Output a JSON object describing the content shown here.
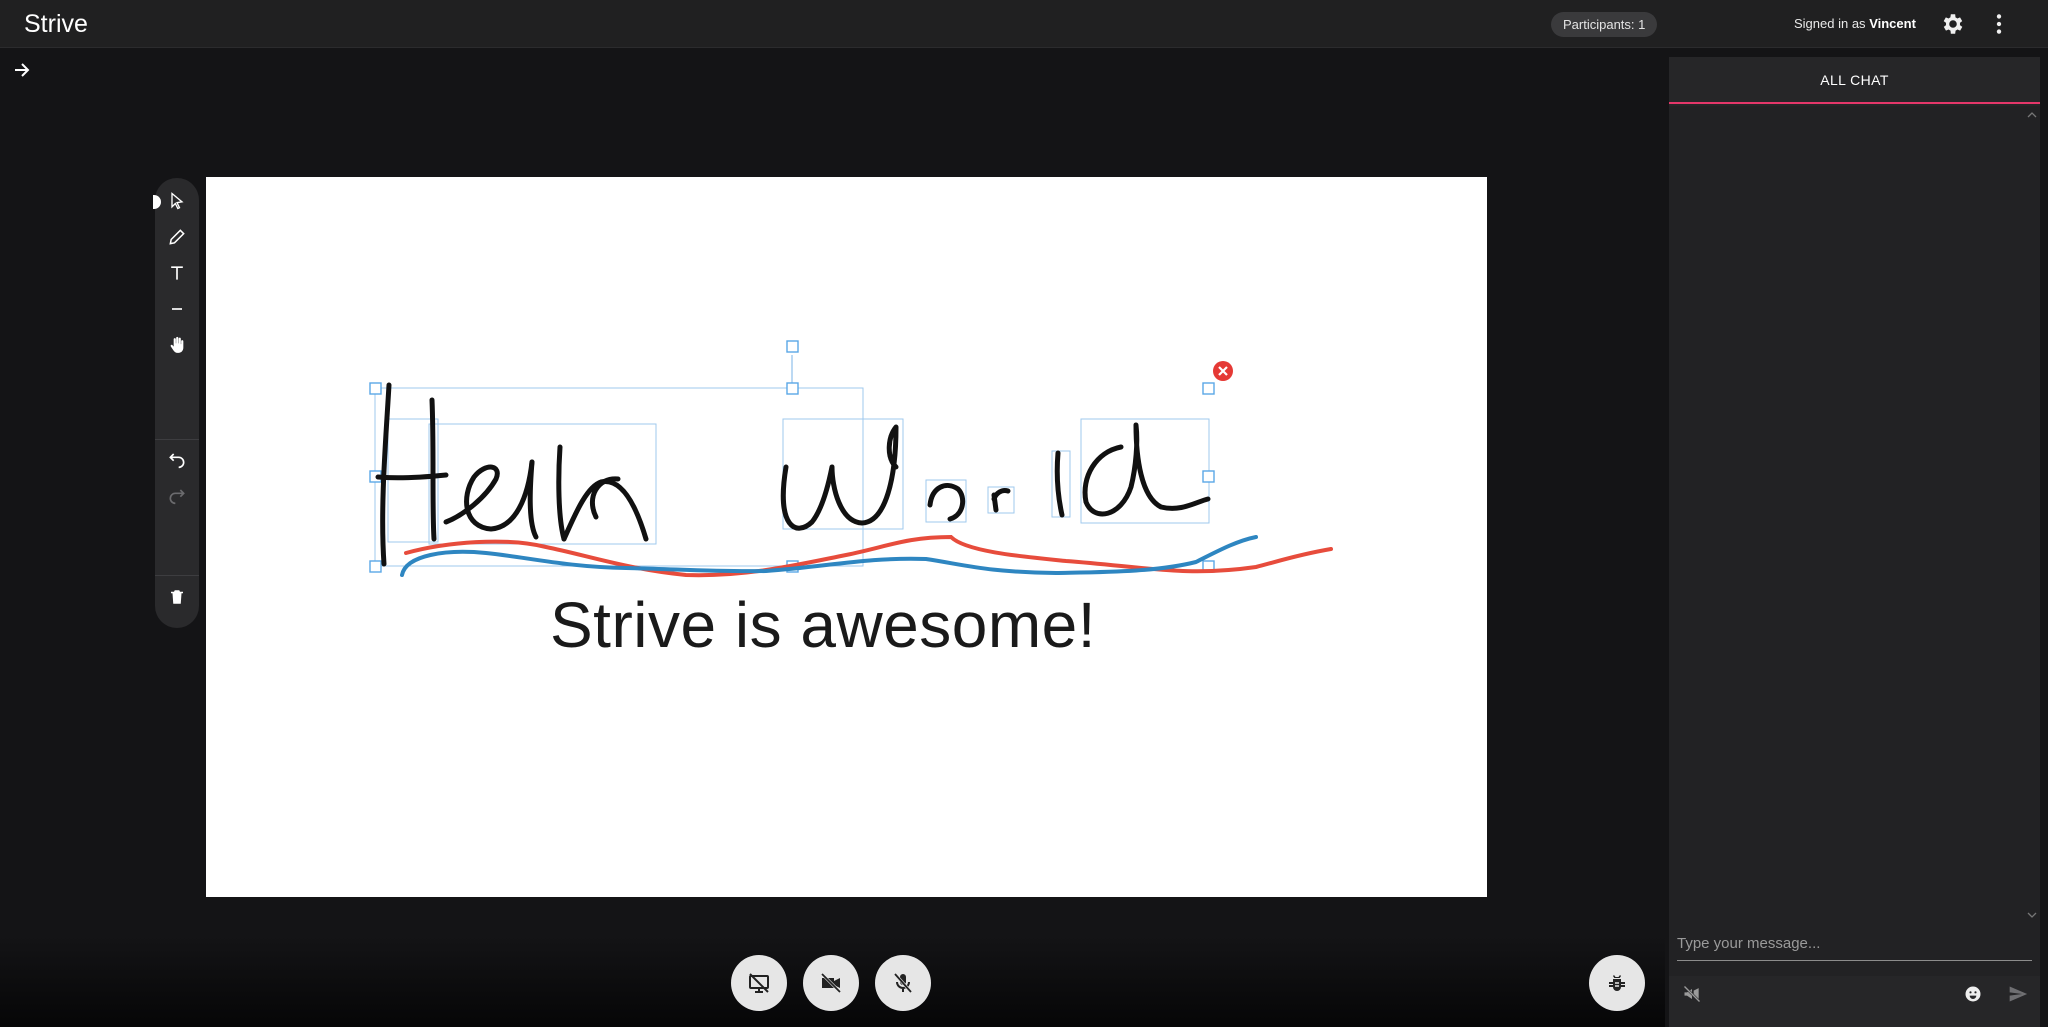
{
  "app": {
    "title": "Strive"
  },
  "header": {
    "participants": "Participants: 1",
    "signed_in_prefix": "Signed in as",
    "user_name": "Vincent",
    "icons": [
      "gear-icon",
      "more-vert-icon"
    ]
  },
  "toolbar": {
    "tools": [
      "select-pointer-icon",
      "pencil-icon",
      "text-icon",
      "line-icon",
      "hand-pan-icon",
      "undo-icon",
      "redo-icon",
      "trash-icon"
    ],
    "active_tool": "select-pointer"
  },
  "board": {
    "handwriting": "Hello World",
    "caption": "Strive is awesome!",
    "stroke_colors": {
      "ink": "#111111",
      "red": "#e74c3c",
      "blue": "#2e86c1",
      "selection": "#5aa7e6",
      "delete": "#e53935"
    }
  },
  "controls": {
    "buttons": [
      "screen-share-off-icon",
      "video-off-icon",
      "mic-off-icon",
      "bug-report-icon"
    ]
  },
  "chat": {
    "tab_label": "ALL CHAT",
    "input_placeholder": "Type your message...",
    "accent": "#e5376a",
    "icons": [
      "megaphone-icon",
      "emoji-icon",
      "send-icon"
    ]
  }
}
